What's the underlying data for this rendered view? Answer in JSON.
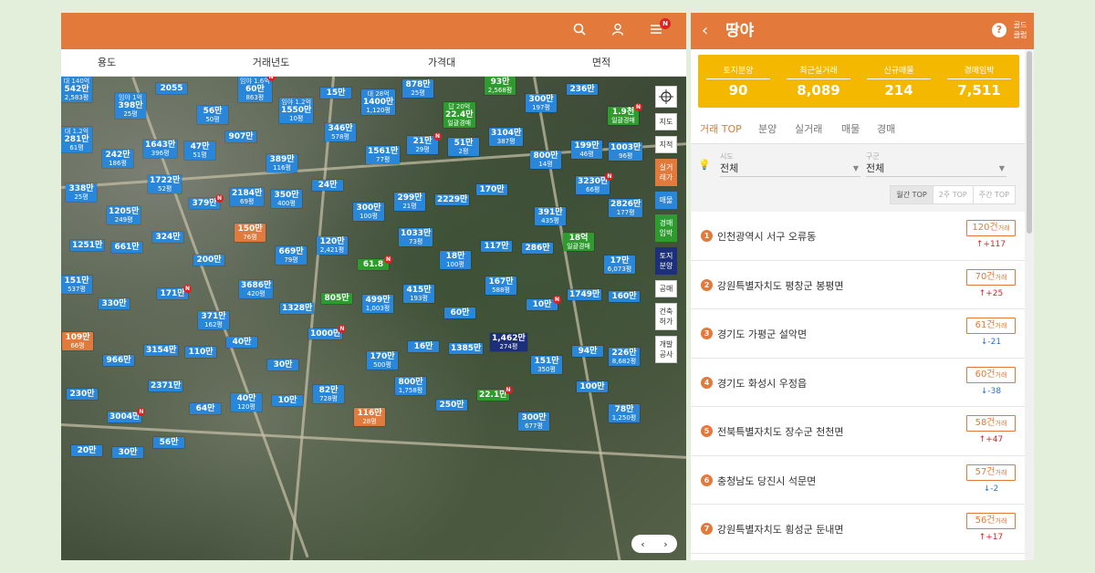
{
  "map": {
    "filters": [
      "용도",
      "거래년도",
      "가격대",
      "면적"
    ],
    "topbar_icons": [
      "search-icon",
      "user-icon",
      "menu-icon"
    ],
    "notif_badge": "N",
    "side_tools": [
      {
        "label": "",
        "icon": "target-icon",
        "style": "target"
      },
      {
        "label": "지도",
        "style": ""
      },
      {
        "label": "지적",
        "style": ""
      },
      {
        "label": "실거래가",
        "style": "c-orange"
      },
      {
        "label": "매물",
        "style": "c-blue"
      },
      {
        "label": "경매임박",
        "style": "c-green"
      },
      {
        "label": "토지분양",
        "style": "c-navy"
      },
      {
        "label": "공매",
        "style": ""
      },
      {
        "label": "건축허가",
        "style": ""
      },
      {
        "label": "개발공사",
        "style": ""
      }
    ],
    "markers": [
      {
        "sub": "대 140억",
        "main": "542만",
        "cnt": "2,583평",
        "color": "blue"
      },
      {
        "sub": "임야 1억",
        "main": "398만",
        "cnt": "25평",
        "color": "blue"
      },
      {
        "sub": "",
        "main": "2055",
        "cnt": "",
        "color": "blue"
      },
      {
        "sub": "",
        "main": "56만",
        "cnt": "50평",
        "color": "blue"
      },
      {
        "sub": "임야 1.6억",
        "main": "60만",
        "cnt": "863평",
        "color": "blue"
      },
      {
        "sub": "임야 1.2억",
        "main": "1550만",
        "cnt": "10평",
        "color": "blue"
      },
      {
        "sub": "",
        "main": "15만",
        "cnt": "",
        "color": "blue"
      },
      {
        "sub": "대 28억",
        "main": "1400만",
        "cnt": "1,120평",
        "color": "blue"
      },
      {
        "sub": "",
        "main": "878만",
        "cnt": "25평",
        "color": "blue"
      },
      {
        "sub": "답 20억",
        "main": "22.4만",
        "cnt": "일괄경매",
        "color": "green"
      },
      {
        "sub": "",
        "main": "93만",
        "cnt": "2,568평",
        "color": "green"
      },
      {
        "sub": "",
        "main": "300만",
        "cnt": "197평",
        "color": "blue"
      },
      {
        "sub": "",
        "main": "236만",
        "cnt": "",
        "color": "blue"
      },
      {
        "sub": "",
        "main": "1.9천",
        "cnt": "일괄경매",
        "color": "green"
      },
      {
        "sub": "대 1.2억",
        "main": "281만",
        "cnt": "61평",
        "color": "blue"
      },
      {
        "sub": "",
        "main": "242만",
        "cnt": "186평",
        "color": "blue"
      },
      {
        "sub": "",
        "main": "1643만",
        "cnt": "396평",
        "color": "blue"
      },
      {
        "sub": "",
        "main": "47만",
        "cnt": "51평",
        "color": "blue"
      },
      {
        "sub": "",
        "main": "907만",
        "cnt": "",
        "color": "blue"
      },
      {
        "sub": "",
        "main": "389만",
        "cnt": "116평",
        "color": "blue"
      },
      {
        "sub": "",
        "main": "346만",
        "cnt": "578평",
        "color": "blue"
      },
      {
        "sub": "",
        "main": "1561만",
        "cnt": "77평",
        "color": "blue"
      },
      {
        "sub": "",
        "main": "21만",
        "cnt": "29평",
        "color": "blue"
      },
      {
        "sub": "",
        "main": "51만",
        "cnt": "2평",
        "color": "blue"
      },
      {
        "sub": "",
        "main": "3104만",
        "cnt": "387평",
        "color": "blue"
      },
      {
        "sub": "",
        "main": "800만",
        "cnt": "14평",
        "color": "blue"
      },
      {
        "sub": "",
        "main": "199만",
        "cnt": "46평",
        "color": "blue"
      },
      {
        "sub": "",
        "main": "1003만",
        "cnt": "96평",
        "color": "blue"
      },
      {
        "sub": "",
        "main": "338만",
        "cnt": "25평",
        "color": "blue"
      },
      {
        "sub": "",
        "main": "1205만",
        "cnt": "249평",
        "color": "blue"
      },
      {
        "sub": "",
        "main": "1722만",
        "cnt": "52평",
        "color": "blue"
      },
      {
        "sub": "",
        "main": "379만",
        "cnt": "",
        "color": "blue"
      },
      {
        "sub": "",
        "main": "2184만",
        "cnt": "69평",
        "color": "blue"
      },
      {
        "sub": "",
        "main": "350만",
        "cnt": "400평",
        "color": "blue"
      },
      {
        "sub": "",
        "main": "24만",
        "cnt": "",
        "color": "blue"
      },
      {
        "sub": "",
        "main": "300만",
        "cnt": "100평",
        "color": "blue"
      },
      {
        "sub": "",
        "main": "299만",
        "cnt": "21평",
        "color": "blue"
      },
      {
        "sub": "",
        "main": "2229만",
        "cnt": "",
        "color": "blue"
      },
      {
        "sub": "",
        "main": "170만",
        "cnt": "",
        "color": "blue"
      },
      {
        "sub": "",
        "main": "391만",
        "cnt": "435평",
        "color": "blue"
      },
      {
        "sub": "",
        "main": "3230만",
        "cnt": "66평",
        "color": "blue"
      },
      {
        "sub": "",
        "main": "2826만",
        "cnt": "177평",
        "color": "blue"
      },
      {
        "sub": "",
        "main": "1251만",
        "cnt": "",
        "color": "blue"
      },
      {
        "sub": "",
        "main": "661만",
        "cnt": "",
        "color": "blue"
      },
      {
        "sub": "",
        "main": "324만",
        "cnt": "",
        "color": "blue"
      },
      {
        "sub": "",
        "main": "200만",
        "cnt": "",
        "color": "blue"
      },
      {
        "sub": "",
        "main": "150만",
        "cnt": "76평",
        "color": "orange"
      },
      {
        "sub": "",
        "main": "669만",
        "cnt": "79평",
        "color": "blue"
      },
      {
        "sub": "",
        "main": "120만",
        "cnt": "2,421평",
        "color": "blue"
      },
      {
        "sub": "",
        "main": "61.8",
        "cnt": "",
        "color": "green"
      },
      {
        "sub": "",
        "main": "1033만",
        "cnt": "73평",
        "color": "blue"
      },
      {
        "sub": "",
        "main": "18만",
        "cnt": "100평",
        "color": "blue"
      },
      {
        "sub": "",
        "main": "117만",
        "cnt": "",
        "color": "blue"
      },
      {
        "sub": "",
        "main": "286만",
        "cnt": "",
        "color": "blue"
      },
      {
        "sub": "",
        "main": "18억",
        "cnt": "일괄경매",
        "color": "green"
      },
      {
        "sub": "",
        "main": "17만",
        "cnt": "6,073평",
        "color": "blue"
      },
      {
        "sub": "",
        "main": "151만",
        "cnt": "537평",
        "color": "blue"
      },
      {
        "sub": "",
        "main": "330만",
        "cnt": "",
        "color": "blue"
      },
      {
        "sub": "",
        "main": "171만",
        "cnt": "",
        "color": "blue"
      },
      {
        "sub": "",
        "main": "371만",
        "cnt": "162평",
        "color": "blue"
      },
      {
        "sub": "",
        "main": "3686만",
        "cnt": "420평",
        "color": "blue"
      },
      {
        "sub": "",
        "main": "1328만",
        "cnt": "",
        "color": "blue"
      },
      {
        "sub": "",
        "main": "805만",
        "cnt": "",
        "color": "green"
      },
      {
        "sub": "",
        "main": "499만",
        "cnt": "1,003평",
        "color": "blue"
      },
      {
        "sub": "",
        "main": "415만",
        "cnt": "193평",
        "color": "blue"
      },
      {
        "sub": "",
        "main": "60만",
        "cnt": "",
        "color": "blue"
      },
      {
        "sub": "",
        "main": "167만",
        "cnt": "588평",
        "color": "blue"
      },
      {
        "sub": "",
        "main": "10만",
        "cnt": "",
        "color": "blue"
      },
      {
        "sub": "",
        "main": "1749만",
        "cnt": "",
        "color": "blue"
      },
      {
        "sub": "",
        "main": "160만",
        "cnt": "",
        "color": "blue"
      },
      {
        "sub": "",
        "main": "109만",
        "cnt": "66평",
        "color": "orange"
      },
      {
        "sub": "",
        "main": "966만",
        "cnt": "",
        "color": "blue"
      },
      {
        "sub": "",
        "main": "3154만",
        "cnt": "",
        "color": "blue"
      },
      {
        "sub": "",
        "main": "110만",
        "cnt": "",
        "color": "blue"
      },
      {
        "sub": "",
        "main": "40만",
        "cnt": "",
        "color": "blue"
      },
      {
        "sub": "",
        "main": "30만",
        "cnt": "",
        "color": "blue"
      },
      {
        "sub": "",
        "main": "1000만",
        "cnt": "",
        "color": "blue"
      },
      {
        "sub": "",
        "main": "170만",
        "cnt": "500평",
        "color": "blue"
      },
      {
        "sub": "",
        "main": "16만",
        "cnt": "",
        "color": "blue"
      },
      {
        "sub": "",
        "main": "1385만",
        "cnt": "",
        "color": "blue"
      },
      {
        "sub": "",
        "main": "1,462만",
        "cnt": "274평",
        "color": "navy"
      },
      {
        "sub": "",
        "main": "151만",
        "cnt": "350평",
        "color": "blue"
      },
      {
        "sub": "",
        "main": "94만",
        "cnt": "",
        "color": "blue"
      },
      {
        "sub": "",
        "main": "226만",
        "cnt": "8,682평",
        "color": "blue"
      },
      {
        "sub": "",
        "main": "230만",
        "cnt": "",
        "color": "blue"
      },
      {
        "sub": "",
        "main": "3004만",
        "cnt": "",
        "color": "blue"
      },
      {
        "sub": "",
        "main": "2371만",
        "cnt": "",
        "color": "blue"
      },
      {
        "sub": "",
        "main": "64만",
        "cnt": "",
        "color": "blue"
      },
      {
        "sub": "",
        "main": "40만",
        "cnt": "120평",
        "color": "blue"
      },
      {
        "sub": "",
        "main": "10만",
        "cnt": "",
        "color": "blue"
      },
      {
        "sub": "",
        "main": "82만",
        "cnt": "728평",
        "color": "blue"
      },
      {
        "sub": "",
        "main": "116만",
        "cnt": "28평",
        "color": "orange"
      },
      {
        "sub": "",
        "main": "800만",
        "cnt": "1,758평",
        "color": "blue"
      },
      {
        "sub": "",
        "main": "250만",
        "cnt": "",
        "color": "blue"
      },
      {
        "sub": "",
        "main": "22.1만",
        "cnt": "",
        "color": "green"
      },
      {
        "sub": "",
        "main": "300만",
        "cnt": "677평",
        "color": "blue"
      },
      {
        "sub": "",
        "main": "100만",
        "cnt": "",
        "color": "blue"
      },
      {
        "sub": "",
        "main": "78만",
        "cnt": "1,250평",
        "color": "blue"
      },
      {
        "sub": "",
        "main": "20만",
        "cnt": "",
        "color": "blue"
      },
      {
        "sub": "",
        "main": "30만",
        "cnt": "",
        "color": "blue"
      },
      {
        "sub": "",
        "main": "56만",
        "cnt": "",
        "color": "blue"
      }
    ]
  },
  "panel": {
    "title": "땅야",
    "gold_label": "골드클럽",
    "stats": [
      {
        "label": "토지분양",
        "value": "90"
      },
      {
        "label": "최근실거래",
        "value": "8,089"
      },
      {
        "label": "신규매물",
        "value": "214"
      },
      {
        "label": "경매임박",
        "value": "7,511"
      }
    ],
    "tabs": [
      "거래 TOP",
      "분양",
      "실거래",
      "매물",
      "경매"
    ],
    "filters": {
      "region_label": "시도",
      "region_value": "전체",
      "district_label": "구군",
      "district_value": "전체"
    },
    "period_tabs": [
      "월간 TOP",
      "2주 TOP",
      "주간 TOP"
    ],
    "ranks": [
      {
        "num": "1",
        "name": "인천광역시 서구 오류동",
        "count": "120건",
        "unit": "거래",
        "change": "↑+117",
        "dir": "up"
      },
      {
        "num": "2",
        "name": "강원특별자치도 평창군 봉평면",
        "count": "70건",
        "unit": "거래",
        "change": "↑+25",
        "dir": "up"
      },
      {
        "num": "3",
        "name": "경기도 가평군 설악면",
        "count": "61건",
        "unit": "거래",
        "change": "↓-21",
        "dir": "down"
      },
      {
        "num": "4",
        "name": "경기도 화성시 우정읍",
        "count": "60건",
        "unit": "거래",
        "change": "↓-38",
        "dir": "down"
      },
      {
        "num": "5",
        "name": "전북특별자치도 장수군 천천면",
        "count": "58건",
        "unit": "거래",
        "change": "↑+47",
        "dir": "up"
      },
      {
        "num": "6",
        "name": "충청남도 당진시 석문면",
        "count": "57건",
        "unit": "거래",
        "change": "↓-2",
        "dir": "down"
      },
      {
        "num": "7",
        "name": "강원특별자치도 횡성군 둔내면",
        "count": "56건",
        "unit": "거래",
        "change": "↑+17",
        "dir": "up"
      }
    ]
  }
}
